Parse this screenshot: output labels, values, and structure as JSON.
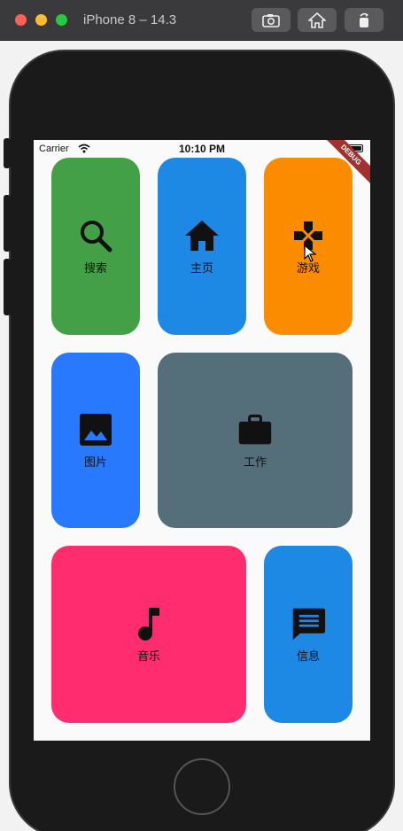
{
  "window": {
    "title": "iPhone 8 – 14.3"
  },
  "status": {
    "carrier": "Carrier",
    "time": "10:10 PM"
  },
  "banner": "DEBUG",
  "tiles": [
    {
      "label": "搜索",
      "icon": "search-icon",
      "color": "#43a047"
    },
    {
      "label": "主页",
      "icon": "home-icon",
      "color": "#1e88e5"
    },
    {
      "label": "游戏",
      "icon": "gamepad-icon",
      "color": "#fb8c00"
    },
    {
      "label": "图片",
      "icon": "image-icon",
      "color": "#2979ff"
    },
    {
      "label": "工作",
      "icon": "briefcase-icon",
      "color": "#546e7a"
    },
    {
      "label": "音乐",
      "icon": "music-note-icon",
      "color": "#ff2d6f"
    },
    {
      "label": "信息",
      "icon": "message-icon",
      "color": "#1e88e5"
    }
  ]
}
